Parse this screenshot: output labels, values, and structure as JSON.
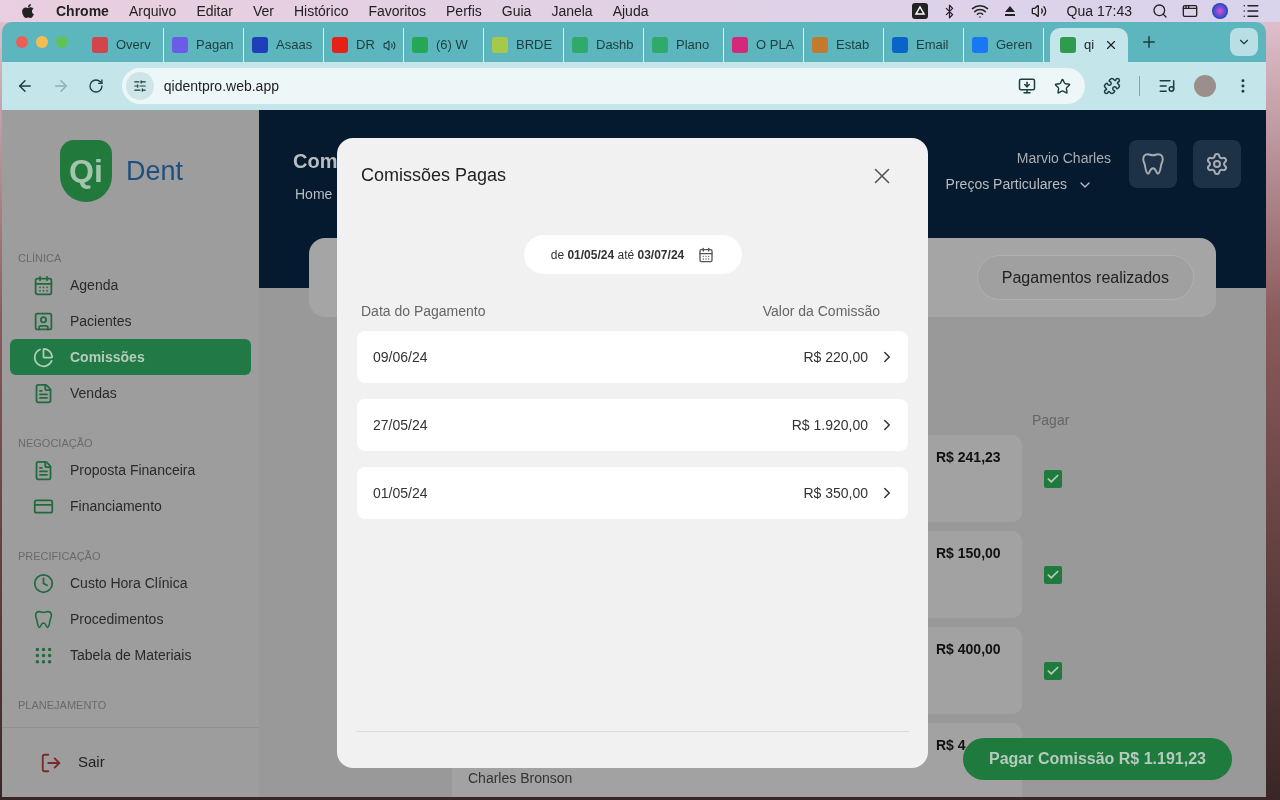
{
  "menu_bar": {
    "app": "Chrome",
    "menus": [
      "Arquivo",
      "Editar",
      "Ver",
      "Histórico",
      "Favoritos",
      "Perfis",
      "Guia",
      "Janela",
      "Ajuda"
    ],
    "clock": "Qua 17:43"
  },
  "browser": {
    "tabs": [
      {
        "label": "Overv",
        "selected": false,
        "color": "#d2454a",
        "audio": false
      },
      {
        "label": "Pagan",
        "selected": false,
        "color": "#6b5ce7",
        "audio": false
      },
      {
        "label": "Asaas",
        "selected": false,
        "color": "#1d3fb8",
        "audio": false
      },
      {
        "label": "DR",
        "selected": false,
        "color": "#e62117",
        "audio": true
      },
      {
        "label": "(6) W",
        "selected": false,
        "color": "#25a855",
        "audio": false
      },
      {
        "label": "BRDE",
        "selected": false,
        "color": "#a6c94a",
        "audio": false
      },
      {
        "label": "Dashb",
        "selected": false,
        "color": "#2faa6a",
        "audio": false
      },
      {
        "label": "Plano",
        "selected": false,
        "color": "#2faa6a",
        "audio": false
      },
      {
        "label": "O PLA",
        "selected": false,
        "color": "#d6287a",
        "audio": false
      },
      {
        "label": "Estab",
        "selected": false,
        "color": "#c47a2c",
        "audio": false
      },
      {
        "label": "Email",
        "selected": false,
        "color": "#0a64c8",
        "audio": false
      },
      {
        "label": "Geren",
        "selected": false,
        "color": "#1877f2",
        "audio": false
      },
      {
        "label": "qi",
        "selected": true,
        "color": "#2e9b4e",
        "audio": false
      }
    ],
    "url": "qidentpro.web.app"
  },
  "sidebar": {
    "logo": {
      "mark": "Qi",
      "name": "Dent"
    },
    "sections": [
      {
        "title": "CLÍNICA",
        "items": [
          {
            "label": "Agenda",
            "selected": false
          },
          {
            "label": "Pacientes",
            "selected": false
          },
          {
            "label": "Comissões",
            "selected": true
          },
          {
            "label": "Vendas",
            "selected": false
          }
        ]
      },
      {
        "title": "NEGOCIAÇÃO",
        "items": [
          {
            "label": "Proposta Financeira",
            "selected": false
          },
          {
            "label": "Financiamento",
            "selected": false
          }
        ]
      },
      {
        "title": "PRECIFICAÇÃO",
        "items": [
          {
            "label": "Custo Hora Clínica",
            "selected": false
          },
          {
            "label": "Procedimentos",
            "selected": false
          },
          {
            "label": "Tabela de Materiais",
            "selected": false
          }
        ]
      },
      {
        "title": "PLANEJAMENTO"
      }
    ],
    "logout": "Sair"
  },
  "page": {
    "title": "Com",
    "breadcrumb": "Home",
    "user": "Marvio Charles",
    "price_table": "Preços Particulares",
    "filter_card": {
      "button": "Pagamentos realizados"
    },
    "pay_column": "Pagar",
    "rows": [
      {
        "amount": "R$ 241,23",
        "checked": true
      },
      {
        "amount": "R$ 150,00",
        "checked": true
      },
      {
        "amount": "R$ 400,00",
        "checked": true
      },
      {
        "name": "Charles Bronson",
        "amount": "R$ 4"
      }
    ],
    "pay_button": "Pagar Comissão R$ 1.191,23"
  },
  "modal": {
    "title": "Comissões Pagas",
    "date_range": "de **01/05/24** até **03/07/24**",
    "columns": [
      "Data do Pagamento",
      "Valor da Comissão"
    ],
    "rows": [
      {
        "date": "09/06/24",
        "value": "R$ 220,00"
      },
      {
        "date": "27/05/24",
        "value": "R$ 1.920,00"
      },
      {
        "date": "01/05/24",
        "value": "R$ 350,00"
      }
    ]
  }
}
